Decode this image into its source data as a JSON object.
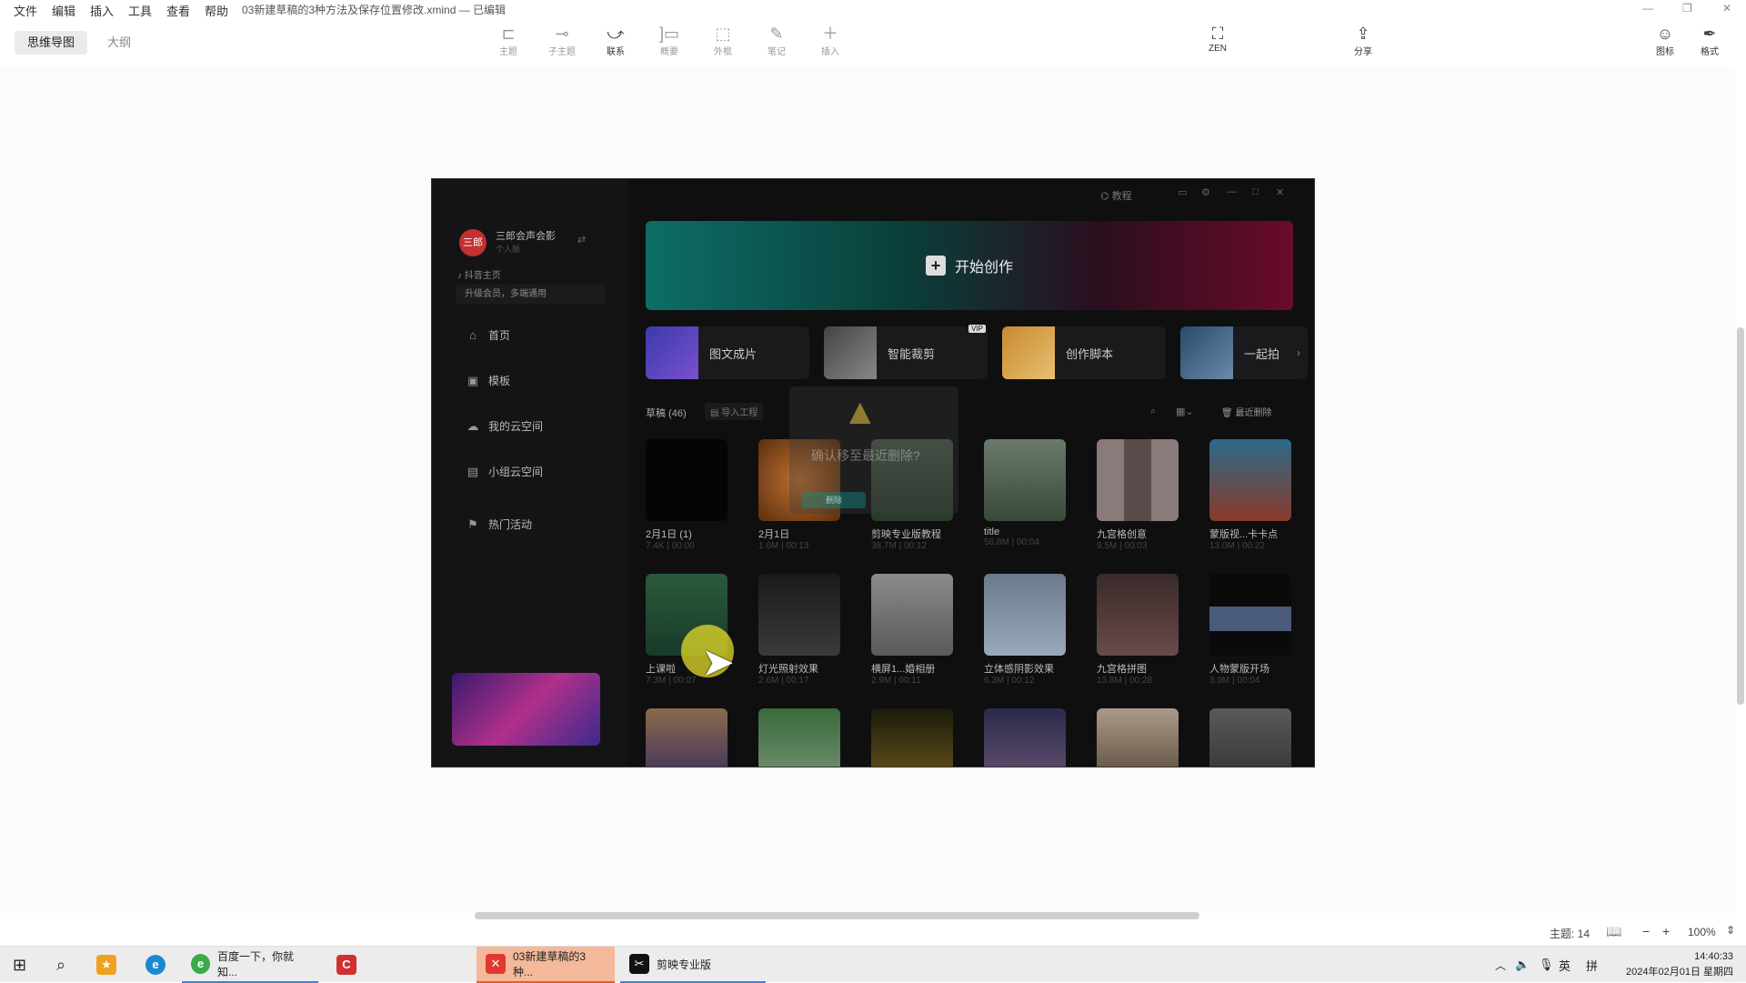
{
  "menubar": {
    "items": [
      "文件",
      "编辑",
      "插入",
      "工具",
      "查看",
      "帮助"
    ],
    "doc_title": "03新建草稿的3种方法及保存位置修改.xmind",
    "doc_status": "— 已编辑"
  },
  "view_tabs": [
    "思维导图",
    "大纲"
  ],
  "toolbar": {
    "topic": "主题",
    "subtopic": "子主题",
    "relation": "联系",
    "summary": "概要",
    "boundary": "外框",
    "note": "笔记",
    "insert": "插入",
    "zen": "ZEN",
    "share": "分享",
    "icon": "图标",
    "format": "格式"
  },
  "embedded_app": {
    "tutorial": "教程",
    "user_name": "三郎会声会影",
    "user_sub": "个人版",
    "douyin": "抖音主页",
    "upgrade": "升级会员，多端通用",
    "nav": [
      "首页",
      "模板",
      "我的云空间",
      "小组云空间",
      "热门活动"
    ],
    "start_creating": "开始创作",
    "quick_actions": [
      "图文成片",
      "智能裁剪",
      "创作脚本",
      "一起拍"
    ],
    "vip_badge": "VIP",
    "drafts_label": "草稿 (46)",
    "import_project": "导入工程",
    "recent_delete": "最近删除",
    "dialog_text": "确认移至最近删除?",
    "dialog_btn": "删除",
    "drafts": [
      {
        "name": "2月1日 (1)",
        "meta": "7.4K | 00:00"
      },
      {
        "name": "2月1日",
        "meta": "1.6M | 00:13"
      },
      {
        "name": "剪映专业版教程",
        "meta": "38.7M | 00:12"
      },
      {
        "name": "title",
        "meta": "56.8M | 00:04"
      },
      {
        "name": "九宫格创意",
        "meta": "9.5M | 00:03"
      },
      {
        "name": "蒙版视...卡卡点",
        "meta": "13.0M | 00:22"
      },
      {
        "name": "上课啦",
        "meta": "7.3M | 00:07"
      },
      {
        "name": "灯光照射效果",
        "meta": "2.6M | 00:17"
      },
      {
        "name": "横屏1...婚相册",
        "meta": "2.9M | 00:11"
      },
      {
        "name": "立体感阴影效果",
        "meta": "6.3M | 00:12"
      },
      {
        "name": "九宫格拼图",
        "meta": "13.8M | 00:28"
      },
      {
        "name": "人物蒙版开场",
        "meta": "3.9M | 00:04"
      }
    ]
  },
  "statusbar": {
    "topics": "主题: 14",
    "zoom": "100%"
  },
  "taskbar": {
    "apps": [
      "百度一下，你就知...",
      "03新建草稿的3种...",
      "剪映专业版"
    ],
    "ime_lang": "英",
    "ime_mode": "拼",
    "time": "14:40:33",
    "date": "2024年02月01日 星期四"
  }
}
